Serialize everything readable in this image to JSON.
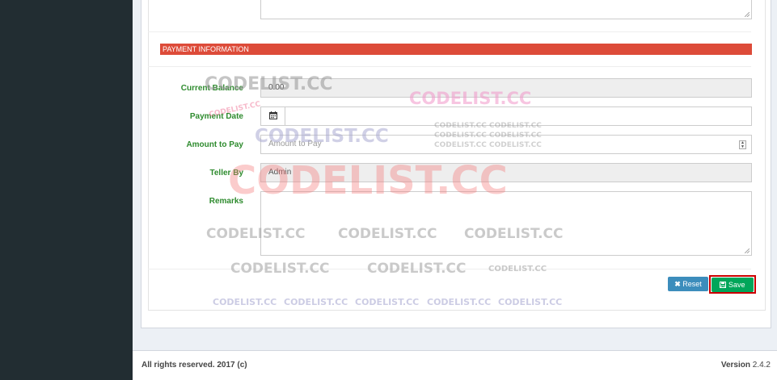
{
  "section": {
    "title": "PAYMENT INFORMATION"
  },
  "form": {
    "current_balance": {
      "label": "Current Balance",
      "value": "0.00"
    },
    "payment_date": {
      "label": "Payment Date",
      "value": ""
    },
    "amount_to_pay": {
      "label": "Amount to Pay",
      "placeholder": "Amount to Pay"
    },
    "teller_by": {
      "label": "Teller By",
      "value": "Admin"
    },
    "remarks": {
      "label": "Remarks",
      "value": ""
    }
  },
  "buttons": {
    "reset": "Reset",
    "save": "Save"
  },
  "footer": {
    "copyright": "All rights reserved. 2017 (c)",
    "version_label": "Version",
    "version_value": "2.4.2"
  },
  "watermarks": {
    "large": "CODELIST.CC",
    "small": "CODELIST.CC CODELIST.CC",
    "medium": "CODELIST.CC",
    "tiny": "CODELIST.CC",
    "arc": "CODELIST.CC"
  },
  "colors": {
    "sidebar": "#222d32",
    "section_bar": "#dd4b39",
    "label": "#2e8b2e",
    "reset_button": "#3c8dbc",
    "save_button": "#00a65a",
    "highlight": "#cc0000"
  },
  "icons": {
    "calendar": "calendar-icon",
    "reset": "times-icon",
    "save": "floppy-icon"
  }
}
